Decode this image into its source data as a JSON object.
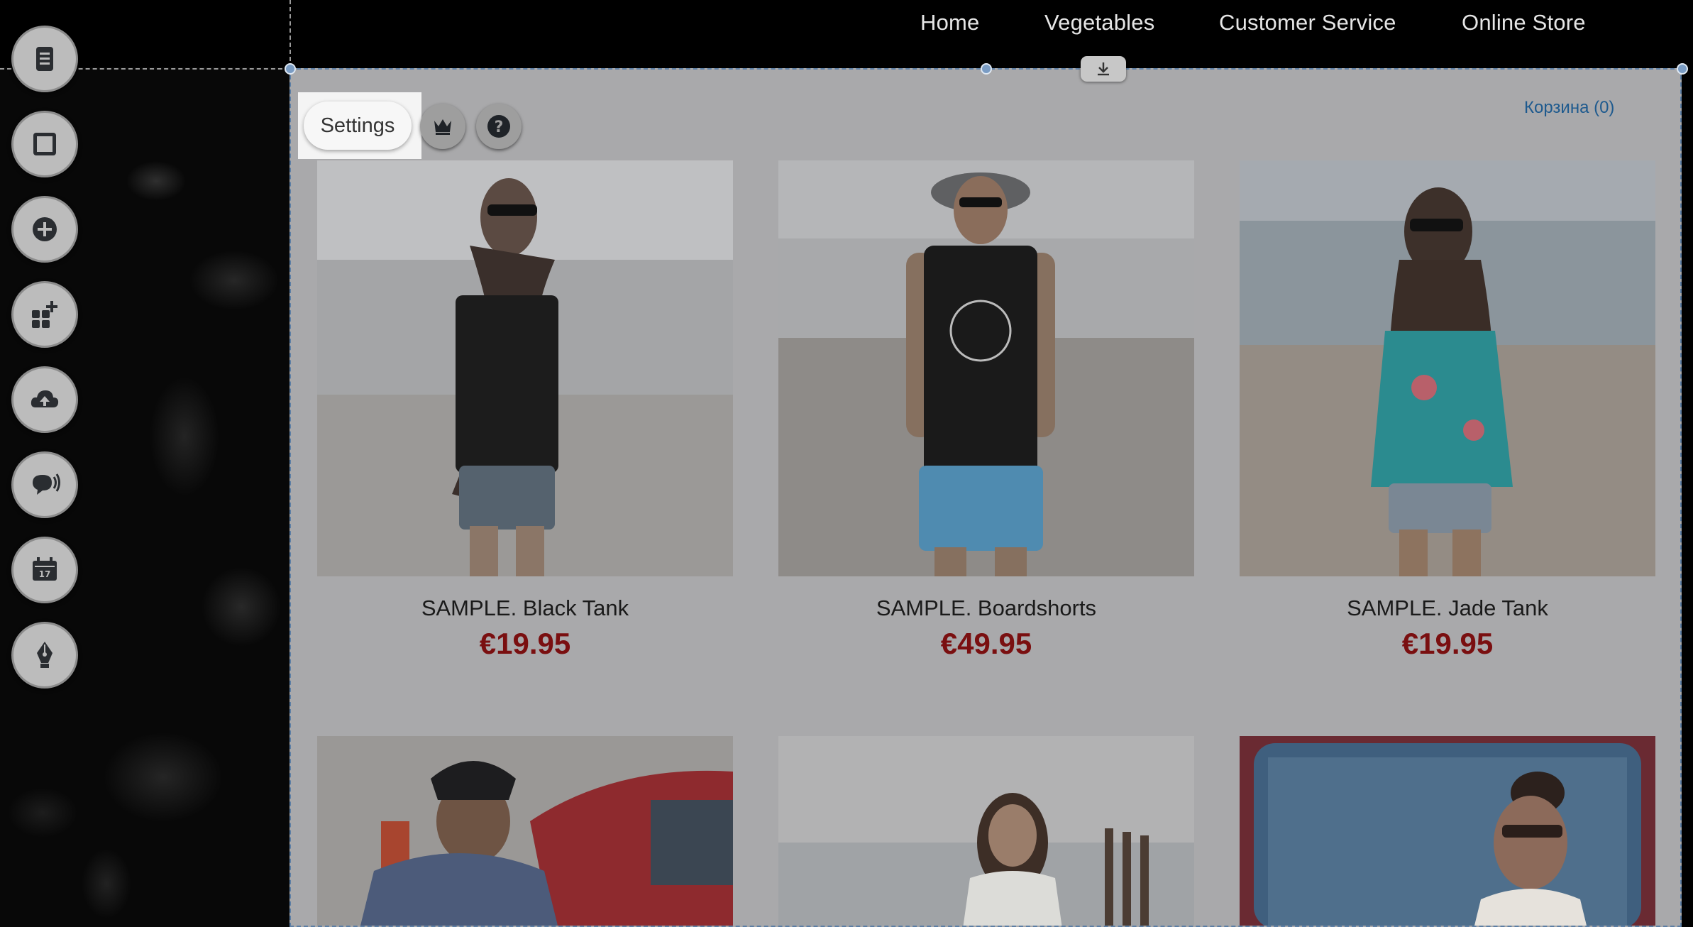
{
  "nav": {
    "items": [
      "Home",
      "Vegetables",
      "Customer Service",
      "Online Store"
    ]
  },
  "toolbar": {
    "icons": [
      "pages-icon",
      "square-icon",
      "add-icon",
      "apps-add-icon",
      "cloud-upload-icon",
      "chat-icon",
      "calendar-icon",
      "pen-icon"
    ],
    "calendar_day": "17"
  },
  "widget": {
    "settings_label": "Settings",
    "cart_label": "Корзина (0)"
  },
  "products": [
    {
      "name": "SAMPLE. Black Tank",
      "price": "€19.95"
    },
    {
      "name": "SAMPLE. Boardshorts",
      "price": "€49.95"
    },
    {
      "name": "SAMPLE. Jade Tank",
      "price": "€19.95"
    }
  ],
  "colors": {
    "price": "#7a0f10",
    "cart_link": "#1e5a8e",
    "selection": "#5d7fa5"
  }
}
